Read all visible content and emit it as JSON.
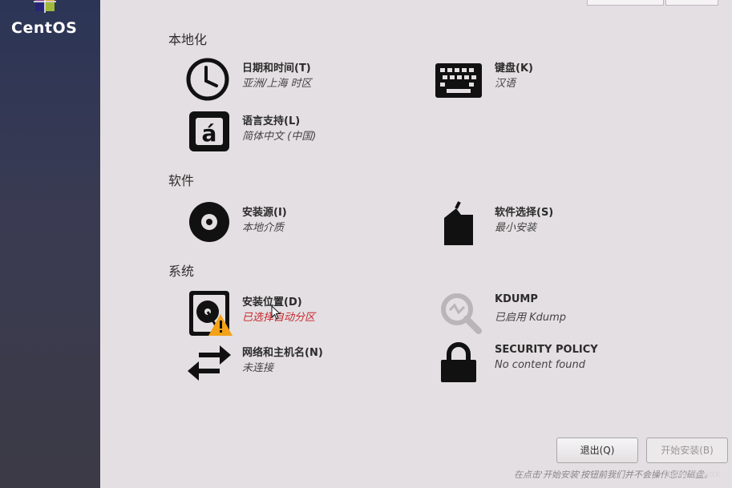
{
  "brand": "CentOS",
  "sections": {
    "localization": "本地化",
    "software": "软件",
    "system": "系统"
  },
  "spokes": {
    "datetime": {
      "title": "日期和时间(T)",
      "status": "亚洲/上海 时区"
    },
    "keyboard": {
      "title": "键盘(K)",
      "status": "汉语"
    },
    "language": {
      "title": "语言支持(L)",
      "status": "简体中文 (中国)"
    },
    "source": {
      "title": "安装源(I)",
      "status": "本地介质"
    },
    "software": {
      "title": "软件选择(S)",
      "status": "最小安装"
    },
    "destination": {
      "title": "安装位置(D)",
      "status": "已选择自动分区"
    },
    "kdump": {
      "title": "KDUMP",
      "status": "已启用 Kdump"
    },
    "network": {
      "title": "网络和主机名(N)",
      "status": "未连接"
    },
    "security": {
      "title": "SECURITY POLICY",
      "status": "No content found"
    }
  },
  "buttons": {
    "quit": "退出(Q)",
    "begin": "开始安装(B)"
  },
  "footer_note": "在点击'开始安装'按钮前我们并不会操作您的磁盘。",
  "watermark": "CSDN @lvattk",
  "colors": {
    "warning": "#c8262c",
    "sidebar": "#2c3556"
  }
}
